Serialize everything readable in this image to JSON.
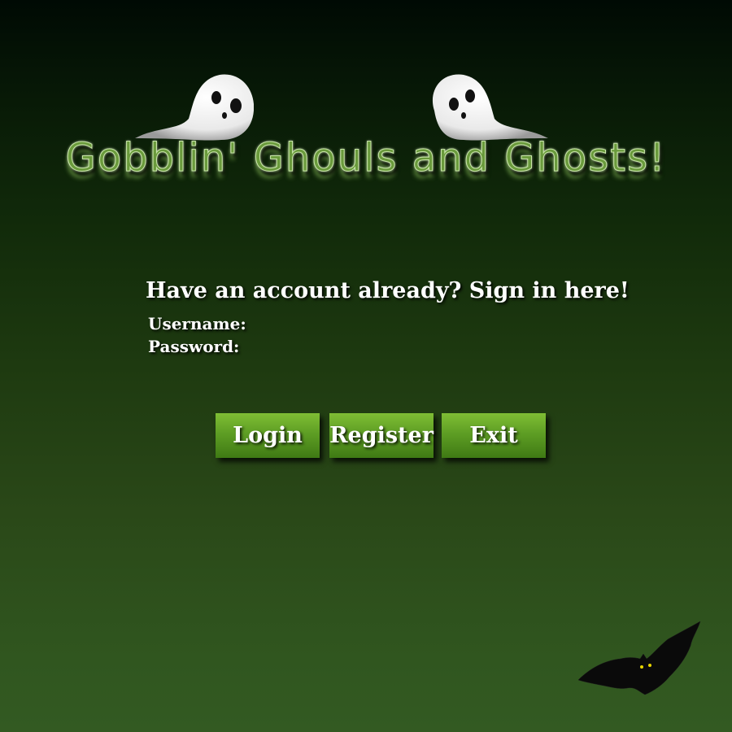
{
  "app": {
    "title": "Gobblin' Ghouls and Ghosts!"
  },
  "signin": {
    "heading": "Have an account already? Sign in here!",
    "username_label": "Username:",
    "password_label": "Password:",
    "username_value": "",
    "password_value": ""
  },
  "buttons": {
    "login": "Login",
    "register": "Register",
    "exit": "Exit"
  },
  "icons": {
    "ghost_left": "ghost-icon",
    "ghost_right": "ghost-icon",
    "bat": "bat-icon"
  },
  "colors": {
    "background_top": "#000a04",
    "background_bottom": "#335a22",
    "title_fill": "#6a9a3c",
    "button_green": "#5e9e24",
    "text": "#ffffff"
  }
}
